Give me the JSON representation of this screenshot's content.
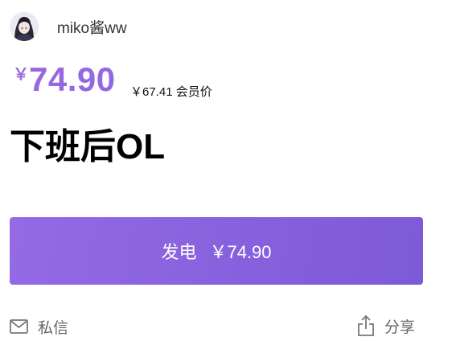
{
  "author": {
    "name": "miko酱ww"
  },
  "price": {
    "currency_symbol": "￥",
    "amount": "74.90",
    "member_price": "￥67.41 会员价"
  },
  "product": {
    "title": "下班后OL"
  },
  "donate_button": {
    "label": "发电",
    "price": "￥74.90"
  },
  "footer": {
    "message_label": "私信",
    "share_label": "分享"
  },
  "colors": {
    "accent": "#9567e2",
    "button_gradient_start": "#946ae6",
    "button_gradient_end": "#7d5ad6"
  },
  "icons": {
    "message": "mail-icon",
    "share": "share-icon"
  }
}
